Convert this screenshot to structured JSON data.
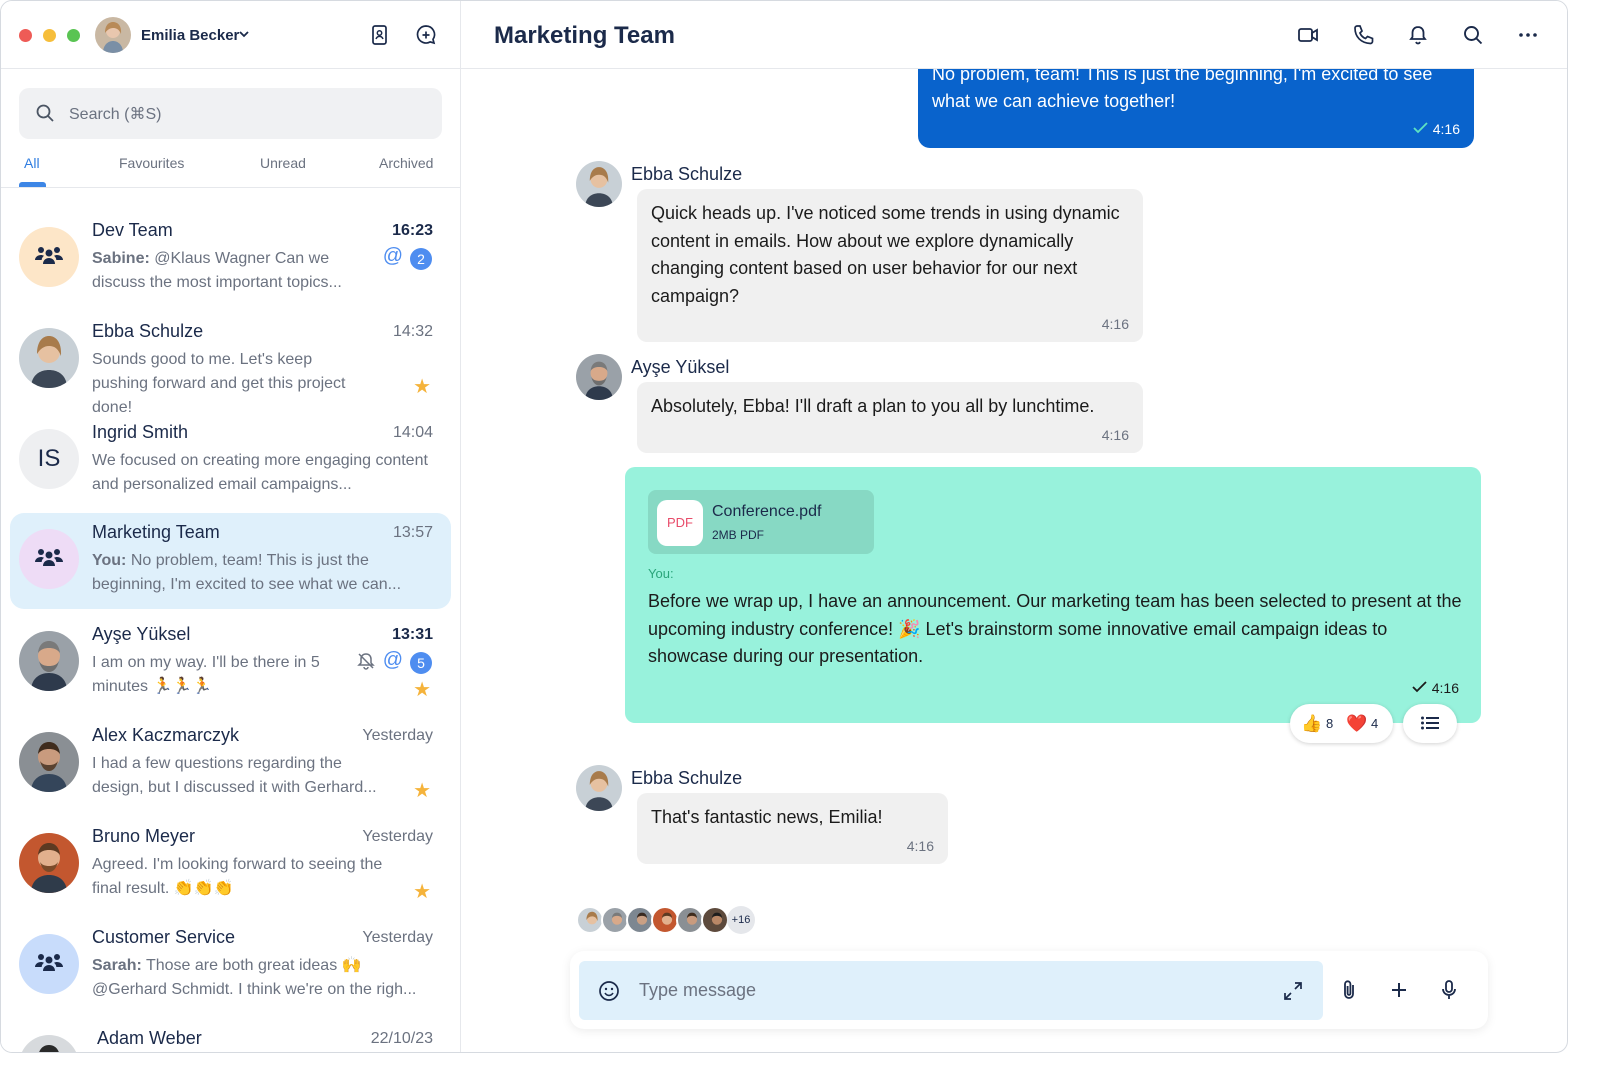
{
  "account": {
    "user_name": "Emilia Becker"
  },
  "search": {
    "placeholder": "Search (⌘S)"
  },
  "tabs": [
    "All",
    "Favourites",
    "Unread",
    "Archived"
  ],
  "chats": [
    {
      "name": "Dev Team",
      "time": "16:23",
      "sender": "Sabine:",
      "preview": "@Klaus Wagner Can we discuss the most important topics...",
      "unread": "2"
    },
    {
      "name": "Ebba Schulze",
      "time": "14:32",
      "preview": "Sounds good to me. Let's keep pushing forward and get this project done!"
    },
    {
      "name": "Ingrid Smith",
      "time": "14:04",
      "initials": "IS",
      "preview": "We focused on creating more engaging content and personalized email campaigns..."
    },
    {
      "name": "Marketing Team",
      "time": "13:57",
      "sender": "You:",
      "preview": "No problem, team! This is just the beginning, I'm excited to see what we can..."
    },
    {
      "name": "Ayşe Yüksel",
      "time": "13:31",
      "preview": "I am on my way. I'll be there in 5 minutes 🏃🏃🏃",
      "unread": "5"
    },
    {
      "name": "Alex Kaczmarczyk",
      "time": "Yesterday",
      "preview": "I had a few questions regarding the design, but I discussed it with Gerhard..."
    },
    {
      "name": "Bruno Meyer",
      "time": "Yesterday",
      "preview": "Agreed. I'm looking forward to seeing the final result. 👏👏👏"
    },
    {
      "name": "Customer Service",
      "time": "Yesterday",
      "sender": "Sarah:",
      "preview": "Those are both great ideas 🙌 @Gerhard Schmidt. I think we're on the righ..."
    },
    {
      "name": "Adam Weber",
      "time": "22/10/23"
    }
  ],
  "conversation": {
    "title": "Marketing Team",
    "messages": [
      {
        "text": "No problem, team! This is just the beginning, I'm excited to see what we can achieve together!",
        "time": "4:16"
      },
      {
        "sender": "Ebba Schulze",
        "text": "Quick heads up. I've noticed some trends in using dynamic content in emails. How about we explore dynamically changing content based on user behavior for our next campaign?",
        "time": "4:16"
      },
      {
        "sender": "Ayşe Yüksel",
        "text": "Absolutely, Ebba! I'll draft a plan to you all by lunchtime.",
        "time": "4:16"
      },
      {
        "sender": "You:",
        "file_name": "Conference.pdf",
        "file_size": "2MB PDF",
        "file_type": "PDF",
        "text": "Before we wrap up, I have an announcement. Our marketing team has been selected to present at the upcoming industry conference! 🎉 Let's brainstorm some innovative email campaign ideas to showcase during our presentation.",
        "time": "4:16",
        "reactions": [
          {
            "emoji": "👍",
            "count": "8"
          },
          {
            "emoji": "❤️",
            "count": "4"
          }
        ]
      },
      {
        "sender": "Ebba Schulze",
        "text": "That's fantastic news, Emilia!",
        "time": "4:16"
      }
    ],
    "seen_more": "+16"
  },
  "composer": {
    "placeholder": "Type message"
  },
  "colors": {
    "accent": "#0963cc",
    "own_message": "#98f2dc",
    "selected_chat": "#dff0fb"
  }
}
